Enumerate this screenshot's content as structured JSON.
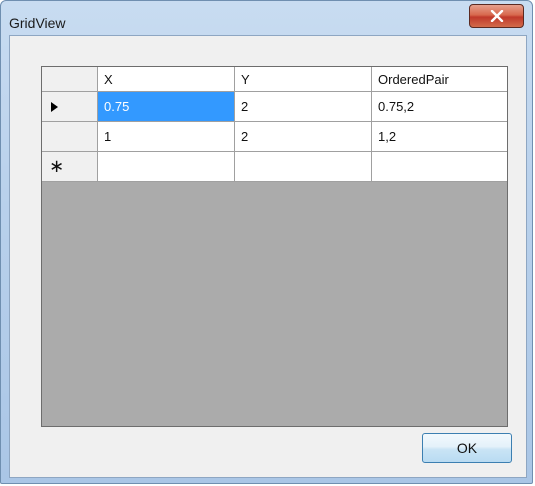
{
  "window": {
    "title": "GridView"
  },
  "grid": {
    "columns": [
      "X",
      "Y",
      "OrderedPair"
    ],
    "rows": [
      {
        "x": "0.75",
        "y": "2",
        "ordered_pair": "0.75,2"
      },
      {
        "x": "1",
        "y": "2",
        "ordered_pair": "1,2"
      }
    ],
    "new_row_marker": "∗",
    "selected_cell": {
      "row": 0,
      "column": "X"
    }
  },
  "buttons": {
    "ok_label": "OK"
  },
  "icons": {
    "close": "close-icon",
    "current_row": "row-pointer-icon",
    "new_row": "new-row-icon"
  },
  "colors": {
    "selection": "#3399ff",
    "grid_background": "#ababab",
    "close_button": "#c0392b"
  }
}
